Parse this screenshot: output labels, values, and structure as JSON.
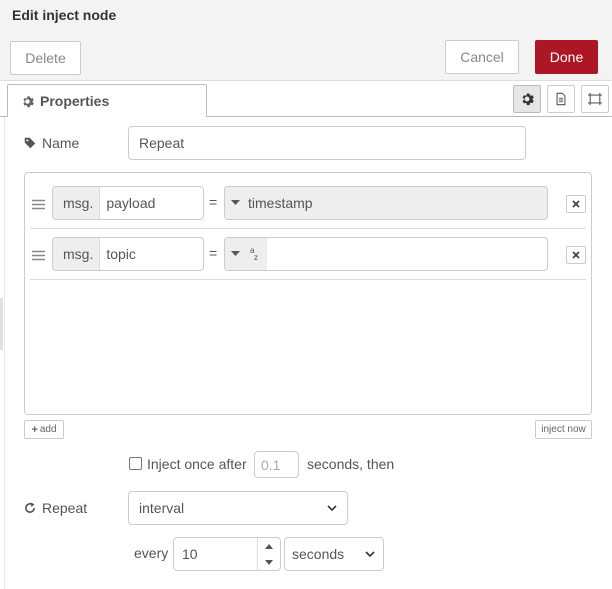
{
  "tray": {
    "title": "Edit inject node",
    "delete_label": "Delete",
    "cancel_label": "Cancel",
    "done_label": "Done",
    "accent_color": "#ad1625"
  },
  "tabs": {
    "properties_label": "Properties",
    "icons": [
      "gear-icon",
      "document-icon",
      "frame-icon"
    ]
  },
  "name": {
    "label": "Name",
    "value": "Repeat"
  },
  "props": [
    {
      "prefix": "msg.",
      "field": "payload",
      "equals": "=",
      "type_icon": "caret-down-icon",
      "value": "timestamp"
    },
    {
      "prefix": "msg.",
      "field": "topic",
      "equals": "=",
      "type_icon": "caret-down-icon",
      "type_glyph": "az",
      "value": ""
    }
  ],
  "actions": {
    "add_label": "add",
    "inject_now_label": "inject now"
  },
  "inject_once": {
    "label": "Inject once after",
    "placeholder": "0.1",
    "suffix": "seconds, then",
    "checked": false
  },
  "repeat": {
    "label": "Repeat",
    "mode": "interval",
    "every_label": "every",
    "every_value": "10",
    "unit": "seconds"
  }
}
